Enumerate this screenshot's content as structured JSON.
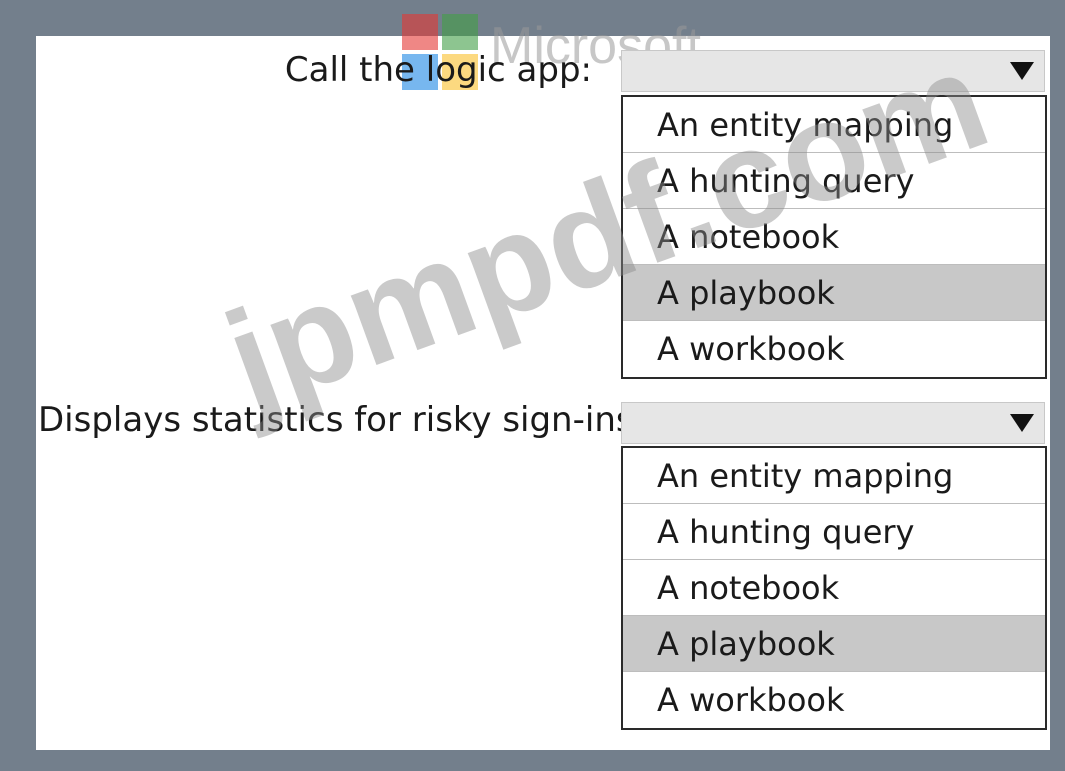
{
  "watermarks": {
    "brand": "Microsoft",
    "site": "jpmpdf.com"
  },
  "questions": [
    {
      "label": "Call the logic app:",
      "selected_value": "",
      "options": [
        {
          "label": "An entity mapping",
          "highlighted": false
        },
        {
          "label": "A hunting query",
          "highlighted": false
        },
        {
          "label": "A notebook",
          "highlighted": false
        },
        {
          "label": "A playbook",
          "highlighted": true
        },
        {
          "label": "A workbook",
          "highlighted": false
        }
      ]
    },
    {
      "label": "Displays statistics for risky sign-ins:",
      "selected_value": "",
      "options": [
        {
          "label": "An entity mapping",
          "highlighted": false
        },
        {
          "label": "A hunting query",
          "highlighted": false
        },
        {
          "label": "A notebook",
          "highlighted": false
        },
        {
          "label": "A playbook",
          "highlighted": true
        },
        {
          "label": "A workbook",
          "highlighted": false
        }
      ]
    }
  ],
  "colors": {
    "frame": "#737f8c",
    "panel": "#ffffff",
    "highlight": "#c8c8c8",
    "select_bg": "#e6e6e6"
  },
  "icons": {
    "dropdown": "caret-down-icon",
    "logo": "microsoft-logo-icon"
  }
}
